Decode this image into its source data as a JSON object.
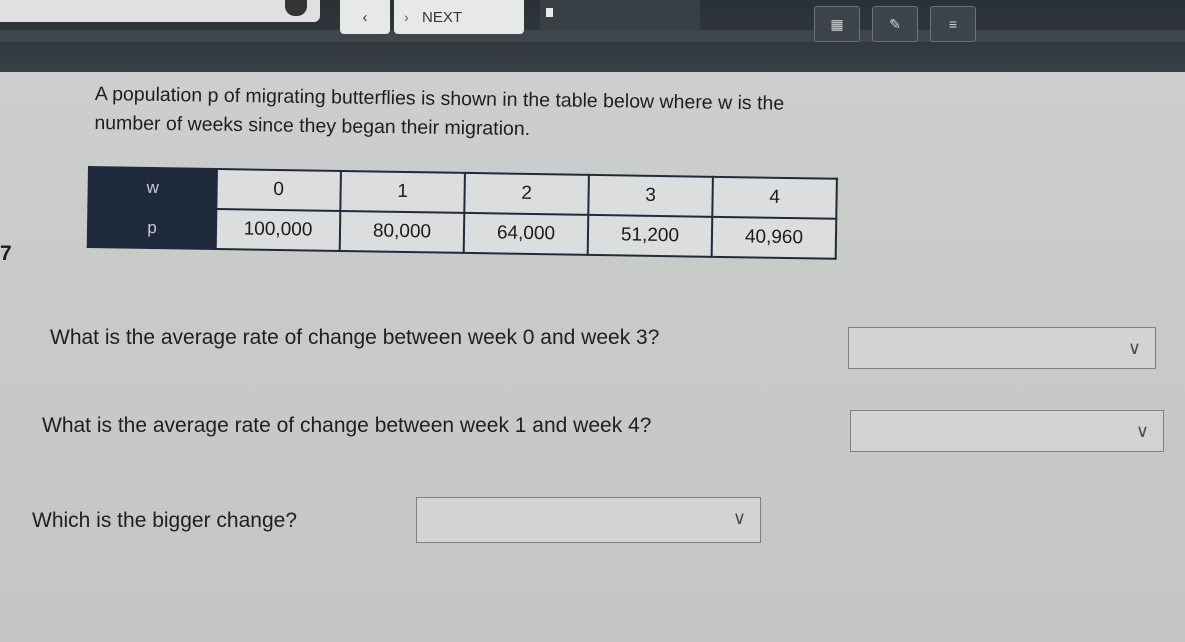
{
  "toolbar": {
    "prev_icon": "chevron-left-icon",
    "next_label": "NEXT"
  },
  "problem": {
    "number": "7",
    "prompt": "A population p of migrating butterflies is shown in the table below where w is the number of weeks since they began their migration."
  },
  "table": {
    "header_row": {
      "label": "w",
      "values": [
        "0",
        "1",
        "2",
        "3",
        "4"
      ]
    },
    "data_row": {
      "label": "p",
      "values": [
        "100,000",
        "80,000",
        "64,000",
        "51,200",
        "40,960"
      ]
    }
  },
  "questions": [
    {
      "text": "What is the average rate of change between week 0 and week 3?",
      "selected": ""
    },
    {
      "text": "What is the average rate of change between week 1 and week 4?",
      "selected": ""
    },
    {
      "text": "Which is the bigger change?",
      "selected": ""
    }
  ],
  "colors": {
    "table_header_bg": "#1f2a3c",
    "toolbar_bg": "#2f353a",
    "page_bg": "#cbcdcb"
  }
}
